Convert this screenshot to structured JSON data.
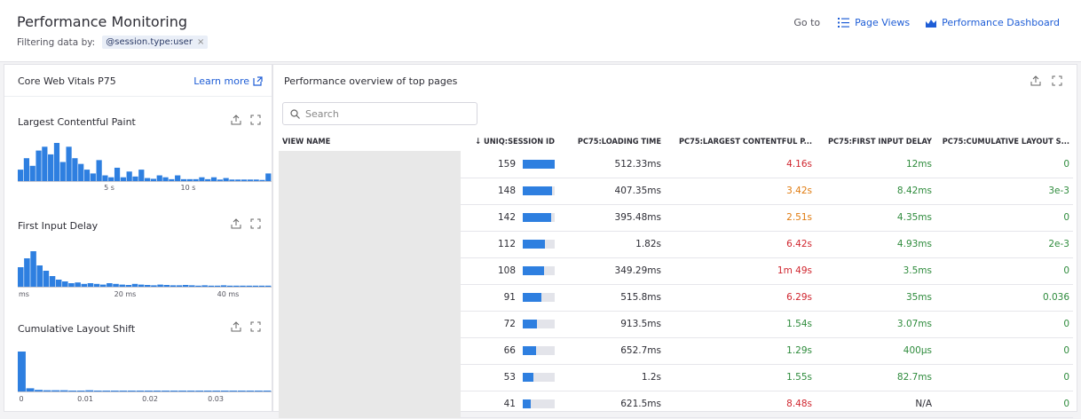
{
  "header": {
    "title": "Performance Monitoring",
    "filter_label": "Filtering data by:",
    "filter_chip": "@session.type:user",
    "filter_remove": "×",
    "goto_label": "Go to",
    "goto_links": [
      "Page Views",
      "Performance Dashboard"
    ]
  },
  "left": {
    "title": "Core Web Vitals P75",
    "learn_more": "Learn more",
    "charts": [
      {
        "title": "Largest Contentful Paint",
        "ticks": [
          "5 s",
          "10 s"
        ]
      },
      {
        "title": "First Input Delay",
        "ticks": [
          "ms",
          "20 ms",
          "40 ms"
        ]
      },
      {
        "title": "Cumulative Layout Shift",
        "ticks": [
          "0",
          "0.01",
          "0.02",
          "0.03"
        ]
      }
    ]
  },
  "chart_data": [
    {
      "type": "bar",
      "title": "Largest Contentful Paint",
      "values": [
        0.3,
        0.6,
        0.4,
        0.8,
        0.9,
        0.7,
        1.0,
        0.5,
        0.9,
        0.6,
        0.45,
        0.3,
        0.2,
        0.55,
        0.15,
        0.1,
        0.35,
        0.1,
        0.25,
        0.12,
        0.3,
        0.08,
        0.06,
        0.15,
        0.1,
        0.05,
        0.15,
        0.05,
        0.05,
        0.05,
        0.1,
        0.05,
        0.1,
        0.04,
        0.08,
        0.04,
        0.04,
        0.04,
        0.04,
        0.04,
        0.03,
        0.2
      ]
    },
    {
      "type": "bar",
      "title": "First Input Delay",
      "values": [
        0.55,
        0.8,
        1.0,
        0.6,
        0.45,
        0.3,
        0.2,
        0.15,
        0.1,
        0.12,
        0.08,
        0.1,
        0.08,
        0.06,
        0.1,
        0.08,
        0.06,
        0.05,
        0.08,
        0.06,
        0.05,
        0.04,
        0.06,
        0.05,
        0.04,
        0.04,
        0.05,
        0.04,
        0.03,
        0.04,
        0.03,
        0.03,
        0.04,
        0.03,
        0.03,
        0.03,
        0.03,
        0.03,
        0.03,
        0.03
      ]
    },
    {
      "type": "bar",
      "title": "Cumulative Layout Shift",
      "values": [
        1.0,
        0.08,
        0.04,
        0.03,
        0.03,
        0.03,
        0.02,
        0.02,
        0.03,
        0.02,
        0.02,
        0.02,
        0.02,
        0.02,
        0.02,
        0.02,
        0.02,
        0.02,
        0.02,
        0.02,
        0.02,
        0.02,
        0.02,
        0.02,
        0.02,
        0.02,
        0.02,
        0.02,
        0.02,
        0.02
      ]
    }
  ],
  "right": {
    "title": "Performance overview of top pages",
    "search_placeholder": "Search",
    "columns": [
      "VIEW NAME",
      "UNIQ:SESSION ID",
      "PC75:LOADING TIME",
      "PC75:LARGEST CONTENTFUL P...",
      "PC75:FIRST INPUT DELAY",
      "PC75:CUMULATIVE LAYOUT S..."
    ],
    "sort_arrow": "↓",
    "rows": [
      {
        "sessions": "159",
        "bar": 1.0,
        "loading": "512.33ms",
        "lcp": "4.16s",
        "lcp_color": "red",
        "fid": "12ms",
        "fid_color": "green",
        "cls": "0",
        "cls_color": "green"
      },
      {
        "sessions": "148",
        "bar": 0.93,
        "loading": "407.35ms",
        "lcp": "3.42s",
        "lcp_color": "orange",
        "fid": "8.42ms",
        "fid_color": "green",
        "cls": "3e-3",
        "cls_color": "green"
      },
      {
        "sessions": "142",
        "bar": 0.89,
        "loading": "395.48ms",
        "lcp": "2.51s",
        "lcp_color": "orange",
        "fid": "4.35ms",
        "fid_color": "green",
        "cls": "0",
        "cls_color": "green"
      },
      {
        "sessions": "112",
        "bar": 0.7,
        "loading": "1.82s",
        "lcp": "6.42s",
        "lcp_color": "red",
        "fid": "4.93ms",
        "fid_color": "green",
        "cls": "2e-3",
        "cls_color": "green"
      },
      {
        "sessions": "108",
        "bar": 0.68,
        "loading": "349.29ms",
        "lcp": "1m 49s",
        "lcp_color": "red",
        "fid": "3.5ms",
        "fid_color": "green",
        "cls": "0",
        "cls_color": "green"
      },
      {
        "sessions": "91",
        "bar": 0.57,
        "loading": "515.8ms",
        "lcp": "6.29s",
        "lcp_color": "red",
        "fid": "35ms",
        "fid_color": "green",
        "cls": "0.036",
        "cls_color": "green"
      },
      {
        "sessions": "72",
        "bar": 0.45,
        "loading": "913.5ms",
        "lcp": "1.54s",
        "lcp_color": "green",
        "fid": "3.07ms",
        "fid_color": "green",
        "cls": "0",
        "cls_color": "green"
      },
      {
        "sessions": "66",
        "bar": 0.42,
        "loading": "652.7ms",
        "lcp": "1.29s",
        "lcp_color": "green",
        "fid": "400µs",
        "fid_color": "green",
        "cls": "0",
        "cls_color": "green"
      },
      {
        "sessions": "53",
        "bar": 0.33,
        "loading": "1.2s",
        "lcp": "1.55s",
        "lcp_color": "green",
        "fid": "82.7ms",
        "fid_color": "green",
        "cls": "0",
        "cls_color": "green"
      },
      {
        "sessions": "41",
        "bar": 0.26,
        "loading": "621.5ms",
        "lcp": "8.48s",
        "lcp_color": "red",
        "fid": "N/A",
        "fid_color": "neutral",
        "cls": "0",
        "cls_color": "green"
      }
    ]
  },
  "colors": {
    "accent": "#1e5dd6",
    "bar": "#2e7fe0",
    "red": "#d0262f",
    "orange": "#e07b10",
    "green": "#2e8b3c"
  }
}
